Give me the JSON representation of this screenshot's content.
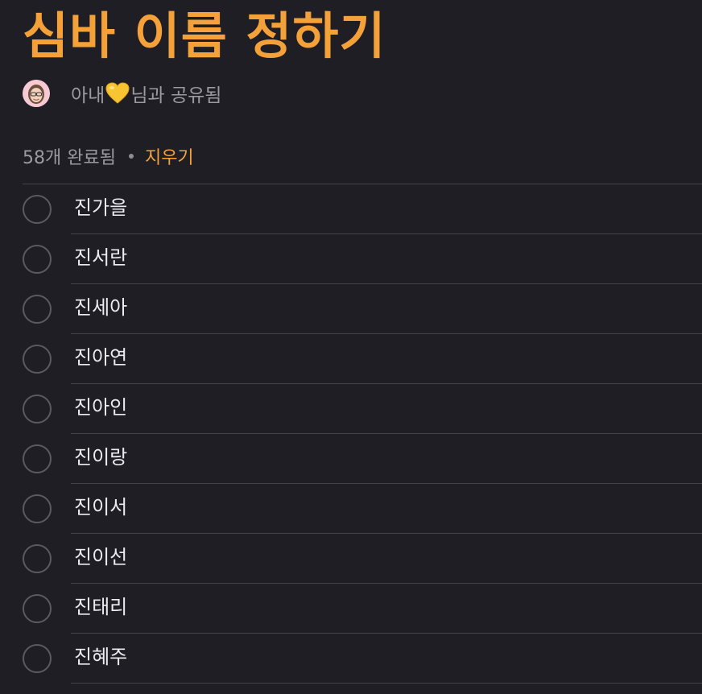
{
  "list": {
    "title": "심바 이름 정하기",
    "shared": {
      "prefix": "아내",
      "suffix": "님과 공유됨",
      "heart_icon": "yellow-heart-icon",
      "avatar_icon": "memoji-avatar-icon"
    },
    "completed": {
      "count_label": "58개 완료됨",
      "clear_label": "지우기"
    },
    "items": [
      {
        "label": "진가을"
      },
      {
        "label": "진서란"
      },
      {
        "label": "진세아"
      },
      {
        "label": "진아연"
      },
      {
        "label": "진아인"
      },
      {
        "label": "진이랑"
      },
      {
        "label": "진이서"
      },
      {
        "label": "진이선"
      },
      {
        "label": "진태리"
      },
      {
        "label": "진혜주"
      }
    ]
  },
  "colors": {
    "background": "#1f1e24",
    "accent": "#f5a13a",
    "secondary_text": "#9a9aa0",
    "divider": "#44434a",
    "checkbox_border": "#5b5a61"
  }
}
